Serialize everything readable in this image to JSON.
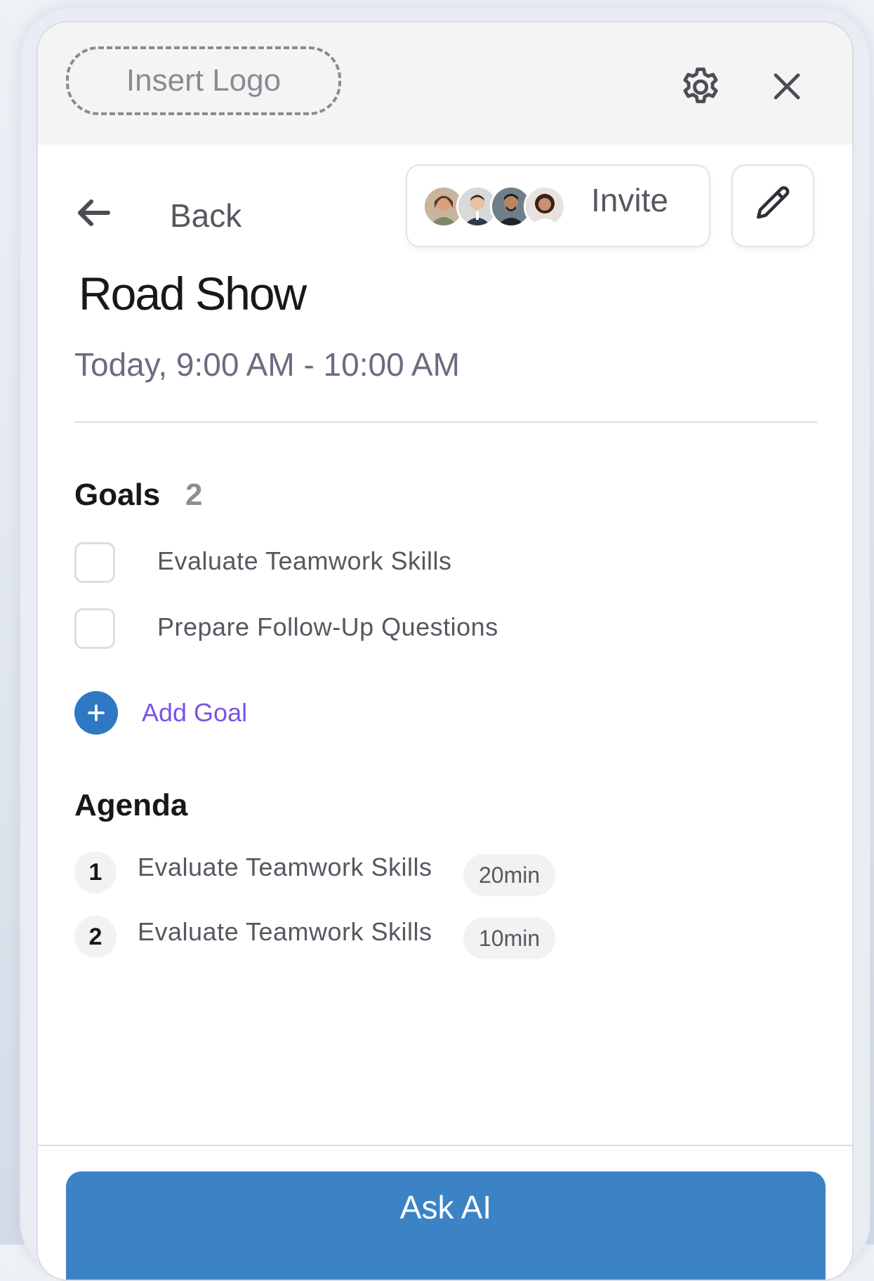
{
  "header": {
    "logo_placeholder": "Insert Logo",
    "settings_icon": "gear-icon",
    "close_icon": "close-icon"
  },
  "toolbar": {
    "back_label": "Back",
    "back_icon": "arrow-left-icon",
    "invite_label": "Invite",
    "edit_icon": "pencil-icon",
    "avatars": [
      {
        "name": "avatar-1",
        "skin": "#d9a079",
        "hair": "#5b3320",
        "bg": "#c9b49e"
      },
      {
        "name": "avatar-2",
        "skin": "#e8c19e",
        "hair": "#3b2a22",
        "bg": "#d9d9d9"
      },
      {
        "name": "avatar-3",
        "skin": "#b98563",
        "hair": "#1f1a18",
        "bg": "#6f7f8a"
      },
      {
        "name": "avatar-4",
        "skin": "#c79274",
        "hair": "#3a2216",
        "bg": "#e7e2dd"
      }
    ]
  },
  "event": {
    "title": "Road Show",
    "time": "Today, 9:00 AM - 10:00 AM"
  },
  "goals": {
    "title": "Goals",
    "count": "2",
    "items": [
      {
        "label": "Evaluate Teamwork Skills",
        "checked": false
      },
      {
        "label": "Prepare Follow-Up Questions",
        "checked": false
      }
    ],
    "add_label": "Add Goal"
  },
  "agenda": {
    "title": "Agenda",
    "items": [
      {
        "number": "1",
        "label": "Evaluate Teamwork Skills",
        "duration": "20min"
      },
      {
        "number": "2",
        "label": "Evaluate Teamwork Skills",
        "duration": "10min"
      }
    ]
  },
  "footer": {
    "ask_ai_label": "Ask AI"
  },
  "colors": {
    "primary": "#3c83c6",
    "accent": "#7b54e6",
    "add_icon": "#2f78c4",
    "text_dark": "#17181c",
    "text_muted": "#565860"
  }
}
